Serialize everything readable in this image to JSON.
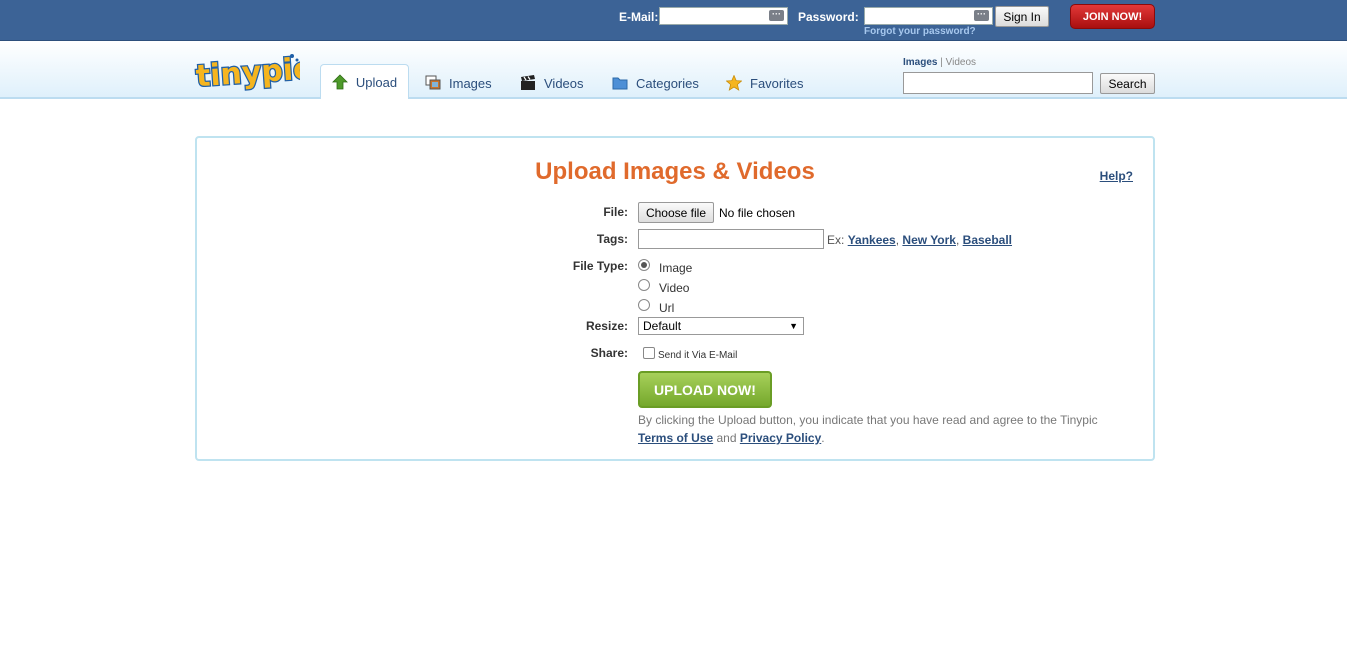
{
  "topbar": {
    "email_label": "E-Mail:",
    "password_label": "Password:",
    "forgot_label": "Forgot your password?",
    "signin_label": "Sign In",
    "join_label": "JOIN NOW!"
  },
  "nav": {
    "logo_text": "tinypic",
    "tabs": [
      {
        "label": "Upload",
        "icon": "upload-arrow-icon",
        "active": true
      },
      {
        "label": "Images",
        "icon": "images-icon"
      },
      {
        "label": "Videos",
        "icon": "clapperboard-icon"
      },
      {
        "label": "Categories",
        "icon": "folder-icon"
      },
      {
        "label": "Favorites",
        "icon": "star-icon"
      }
    ],
    "search": {
      "images_label": "Images",
      "separator": "|",
      "videos_label": "Videos",
      "button_label": "Search",
      "value": ""
    }
  },
  "upload": {
    "title": "Upload Images & Videos",
    "help_label": "Help?",
    "file_label": "File:",
    "choose_label": "Choose file",
    "no_file_label": "No file chosen",
    "tags_label": "Tags:",
    "tags_value": "",
    "ex_label": "Ex:",
    "examples": [
      "Yankees",
      "New York",
      "Baseball"
    ],
    "filetype_label": "File Type:",
    "filetypes": [
      "Image",
      "Video",
      "Url"
    ],
    "selected_filetype": "Image",
    "resize_label": "Resize:",
    "resize_value": "Default",
    "share_label": "Share:",
    "share_option": "Send it Via E-Mail",
    "upload_button": "UPLOAD NOW!",
    "terms_text": "By clicking the Upload button, you indicate that you have read and agree to the Tinypic",
    "terms_link": "Terms of Use",
    "terms_and": "and",
    "privacy_link": "Privacy Policy",
    "terms_end": "."
  },
  "colors": {
    "topbar": "#3c6396",
    "title": "#e06a2c",
    "link": "#2b4e7c",
    "join": "#c41f1f",
    "upload_btn": "#8cbd43"
  }
}
